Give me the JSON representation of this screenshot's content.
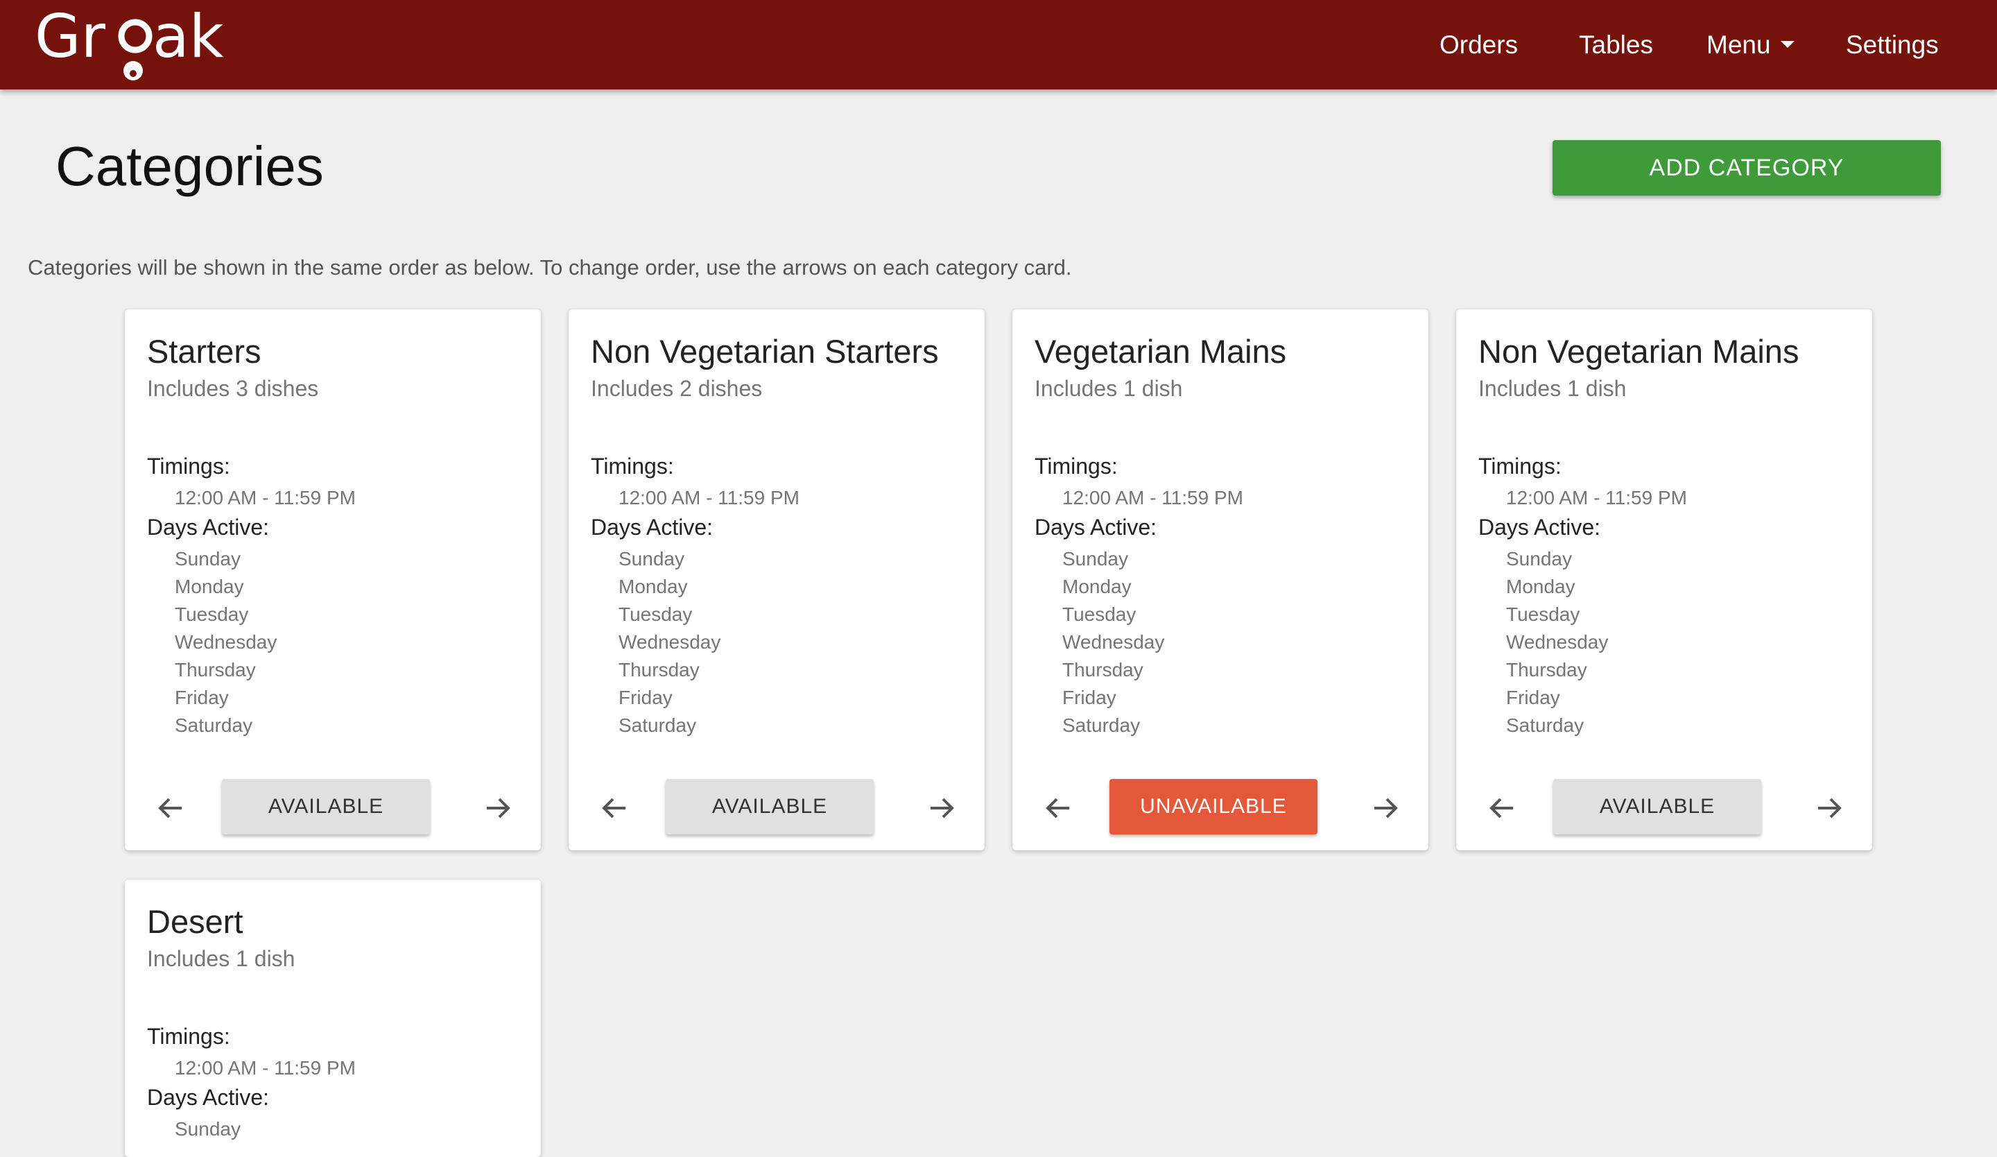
{
  "nav": {
    "logo_text": "Groak",
    "items": [
      "Orders",
      "Tables",
      "Menu",
      "Settings"
    ]
  },
  "page": {
    "title": "Categories",
    "add_button": "ADD CATEGORY",
    "hint": "Categories will be shown in the same order as below. To change order, use the arrows on each category card."
  },
  "colors": {
    "navbar": "#76120c",
    "add_button": "#3f9a39",
    "available_button": "#e0e0e0",
    "unavailable_button": "#e4583a"
  },
  "labels": {
    "timings": "Timings:",
    "days_active": "Days Active:"
  },
  "categories": [
    {
      "title": "Starters",
      "subtitle": "Includes 3 dishes",
      "timing": "12:00 AM - 11:59 PM",
      "days": [
        "Sunday",
        "Monday",
        "Tuesday",
        "Wednesday",
        "Thursday",
        "Friday",
        "Saturday"
      ],
      "status": "AVAILABLE"
    },
    {
      "title": "Non Vegetarian Starters",
      "subtitle": "Includes 2 dishes",
      "timing": "12:00 AM - 11:59 PM",
      "days": [
        "Sunday",
        "Monday",
        "Tuesday",
        "Wednesday",
        "Thursday",
        "Friday",
        "Saturday"
      ],
      "status": "AVAILABLE"
    },
    {
      "title": "Vegetarian Mains",
      "subtitle": "Includes 1 dish",
      "timing": "12:00 AM - 11:59 PM",
      "days": [
        "Sunday",
        "Monday",
        "Tuesday",
        "Wednesday",
        "Thursday",
        "Friday",
        "Saturday"
      ],
      "status": "UNAVAILABLE"
    },
    {
      "title": "Non Vegetarian Mains",
      "subtitle": "Includes 1 dish",
      "timing": "12:00 AM - 11:59 PM",
      "days": [
        "Sunday",
        "Monday",
        "Tuesday",
        "Wednesday",
        "Thursday",
        "Friday",
        "Saturday"
      ],
      "status": "AVAILABLE"
    },
    {
      "title": "Desert",
      "subtitle": "Includes 1 dish",
      "timing": "12:00 AM - 11:59 PM",
      "days": [
        "Sunday"
      ],
      "status": ""
    }
  ],
  "icons": {
    "move_left": "arrow-left-icon",
    "move_right": "arrow-right-icon",
    "menu_caret": "caret-down-icon"
  }
}
